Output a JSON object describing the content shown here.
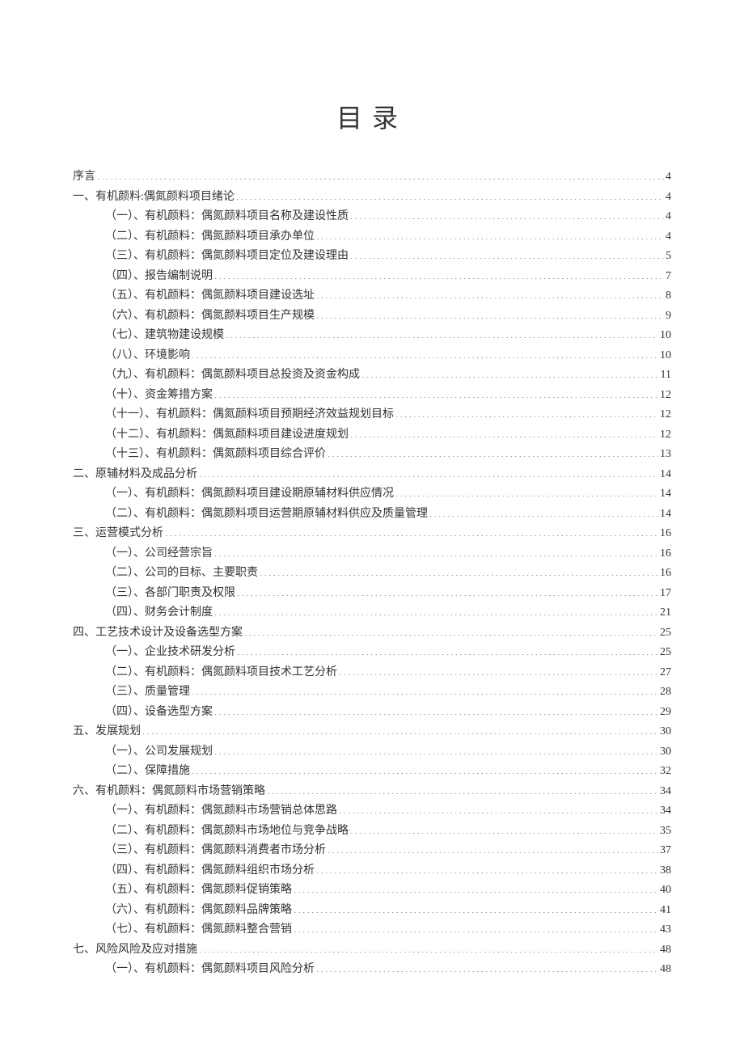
{
  "title": "目录",
  "toc": [
    {
      "level": 0,
      "label": "序言",
      "page": "4"
    },
    {
      "level": 0,
      "label": "一、有机颜料:偶氮颜料项目绪论",
      "page": "4"
    },
    {
      "level": 1,
      "label": "（一）、有机颜料：偶氮颜料项目名称及建设性质",
      "page": "4"
    },
    {
      "level": 1,
      "label": "（二）、有机颜料：偶氮颜料项目承办单位",
      "page": "4"
    },
    {
      "level": 1,
      "label": "（三）、有机颜料：偶氮颜料项目定位及建设理由",
      "page": "5"
    },
    {
      "level": 1,
      "label": "（四）、报告编制说明",
      "page": "7"
    },
    {
      "level": 1,
      "label": "（五）、有机颜料：偶氮颜料项目建设选址",
      "page": "8"
    },
    {
      "level": 1,
      "label": "（六）、有机颜料：偶氮颜料项目生产规模",
      "page": "9"
    },
    {
      "level": 1,
      "label": "（七）、建筑物建设规模",
      "page": "10"
    },
    {
      "level": 1,
      "label": "（八）、环境影响",
      "page": "10"
    },
    {
      "level": 1,
      "label": "（九）、有机颜料：偶氮颜料项目总投资及资金构成",
      "page": "11"
    },
    {
      "level": 1,
      "label": "（十）、资金筹措方案",
      "page": "12"
    },
    {
      "level": 1,
      "label": "（十一）、有机颜料：偶氮颜料项目预期经济效益规划目标",
      "page": "12"
    },
    {
      "level": 1,
      "label": "（十二）、有机颜料：偶氮颜料项目建设进度规划",
      "page": "12"
    },
    {
      "level": 1,
      "label": "（十三）、有机颜料：偶氮颜料项目综合评价",
      "page": "13"
    },
    {
      "level": 0,
      "label": "二、原辅材料及成品分析",
      "page": "14"
    },
    {
      "level": 1,
      "label": "（一）、有机颜料：偶氮颜料项目建设期原辅材料供应情况",
      "page": "14"
    },
    {
      "level": 1,
      "label": "（二）、有机颜料：偶氮颜料项目运营期原辅材料供应及质量管理",
      "page": "14"
    },
    {
      "level": 0,
      "label": "三、运营模式分析",
      "page": "16"
    },
    {
      "level": 1,
      "label": "（一）、公司经营宗旨",
      "page": "16"
    },
    {
      "level": 1,
      "label": "（二）、公司的目标、主要职责",
      "page": "16"
    },
    {
      "level": 1,
      "label": "（三）、各部门职责及权限",
      "page": "17"
    },
    {
      "level": 1,
      "label": "（四）、财务会计制度",
      "page": "21"
    },
    {
      "level": 0,
      "label": "四、工艺技术设计及设备选型方案",
      "page": "25"
    },
    {
      "level": 1,
      "label": "（一）、企业技术研发分析",
      "page": "25"
    },
    {
      "level": 1,
      "label": "（二）、有机颜料：偶氮颜料项目技术工艺分析",
      "page": "27"
    },
    {
      "level": 1,
      "label": "（三）、质量管理",
      "page": "28"
    },
    {
      "level": 1,
      "label": "（四）、设备选型方案",
      "page": "29"
    },
    {
      "level": 0,
      "label": "五、发展规划",
      "page": "30"
    },
    {
      "level": 1,
      "label": "（一）、公司发展规划",
      "page": "30"
    },
    {
      "level": 1,
      "label": "（二）、保障措施",
      "page": "32"
    },
    {
      "level": 0,
      "label": "六、有机颜料：偶氮颜料市场营销策略",
      "page": "34"
    },
    {
      "level": 1,
      "label": "（一）、有机颜料：偶氮颜料市场营销总体思路",
      "page": "34"
    },
    {
      "level": 1,
      "label": "（二）、有机颜料：偶氮颜料市场地位与竞争战略",
      "page": "35"
    },
    {
      "level": 1,
      "label": "（三）、有机颜料：偶氮颜料消费者市场分析",
      "page": "37"
    },
    {
      "level": 1,
      "label": "（四）、有机颜料：偶氮颜料组织市场分析",
      "page": "38"
    },
    {
      "level": 1,
      "label": "（五）、有机颜料：偶氮颜料促销策略",
      "page": "40"
    },
    {
      "level": 1,
      "label": "（六）、有机颜料：偶氮颜料品牌策略",
      "page": "41"
    },
    {
      "level": 1,
      "label": "（七）、有机颜料：偶氮颜料整合营销",
      "page": "43"
    },
    {
      "level": 0,
      "label": "七、风险风险及应对措施",
      "page": "48"
    },
    {
      "level": 1,
      "label": "（一）、有机颜料：偶氮颜料项目风险分析",
      "page": "48"
    }
  ]
}
